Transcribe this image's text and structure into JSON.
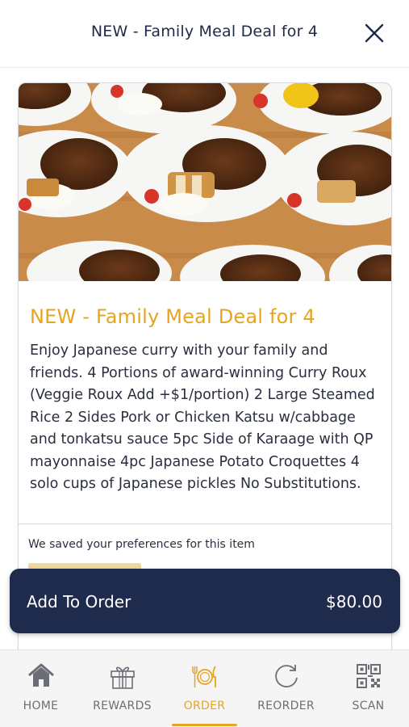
{
  "header": {
    "title": "NEW -  Family  Meal  Deal for 4"
  },
  "item": {
    "title": "NEW -  Family  Meal  Deal for 4",
    "description": "Enjoy Japanese curry with your family and friends. 4  Portions of award-winning Curry Roux (Veggie  Roux Add +$1/portion) 2  Large Steamed  Rice 2 Sides  Pork or Chicken  Katsu w/cabbage and tonkatsu sauce 5pc Side of Karaage with QP mayonnaise 4pc Japanese Potato Croquettes 4 solo cups of Japanese pickles  No Substitutions.",
    "preferences_note": "We saved your preferences for this item"
  },
  "order_bar": {
    "label": "Add To Order",
    "price": "$80.00"
  },
  "tabs": [
    {
      "label": "HOME",
      "icon": "home-icon"
    },
    {
      "label": "REWARDS",
      "icon": "gift-icon"
    },
    {
      "label": "ORDER",
      "icon": "plate-utensils-icon",
      "active": true
    },
    {
      "label": "REORDER",
      "icon": "reorder-icon"
    },
    {
      "label": "SCAN",
      "icon": "qr-code-icon"
    }
  ],
  "colors": {
    "accent": "#e6a520",
    "navy": "#1f2b4d",
    "icon_gray": "#6b6e74"
  }
}
